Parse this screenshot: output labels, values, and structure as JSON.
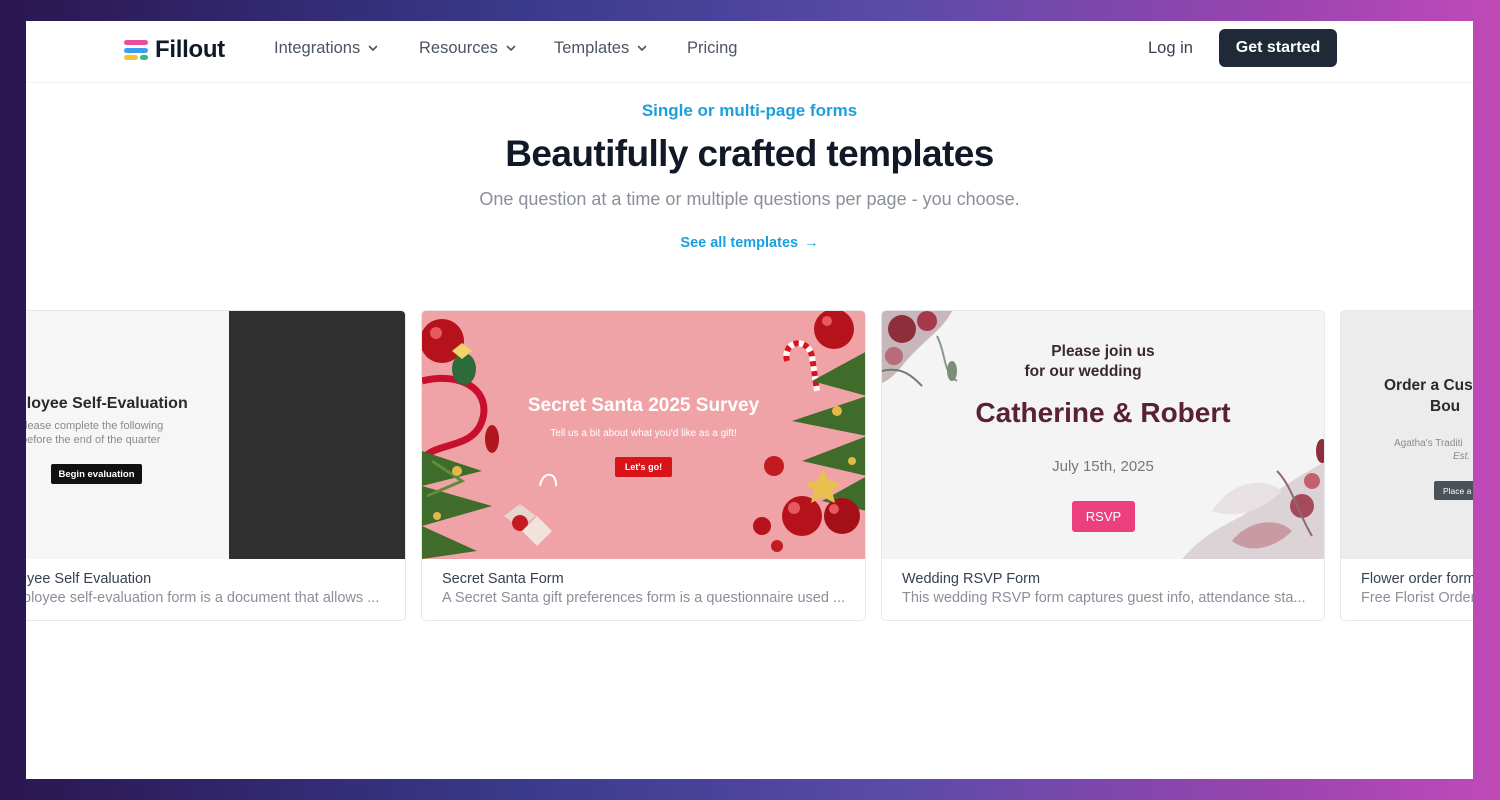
{
  "header": {
    "brand": "Fillout",
    "nav": [
      {
        "label": "Integrations"
      },
      {
        "label": "Resources"
      },
      {
        "label": "Templates"
      },
      {
        "label": "Pricing"
      }
    ],
    "login": "Log in",
    "cta": "Get started"
  },
  "hero": {
    "eyebrow": "Single or multi-page forms",
    "title": "Beautifully crafted templates",
    "subtitle": "One question at a time or multiple questions per page - you choose.",
    "link": "See all templates",
    "link_arrow": "→"
  },
  "cards": [
    {
      "title": "yee Self Evaluation",
      "desc": "ployee self-evaluation form is a document that allows ...",
      "preview": {
        "heading": "ployee Self-Evaluation",
        "line1": "lease complete the following",
        "line2": "before the end of the quarter",
        "button": "Begin evaluation"
      }
    },
    {
      "title": "Secret Santa Form",
      "desc": "A Secret Santa gift preferences form is a questionnaire used ...",
      "preview": {
        "heading": "Secret Santa 2025 Survey",
        "line1": "Tell us a bit about what you'd like as a gift!",
        "button": "Let's go!"
      }
    },
    {
      "title": "Wedding RSVP Form",
      "desc": "This wedding RSVP form captures guest info, attendance sta...",
      "preview": {
        "line1": "Please join us",
        "line2": "for our wedding",
        "heading": "Catherine & Robert",
        "date": "July 15th, 2025",
        "button": "RSVP"
      }
    },
    {
      "title": "Flower order form",
      "desc": "Free Florist Order",
      "preview": {
        "heading1": "Order a Cus",
        "heading2": "Bou",
        "line1": "Agatha's Traditi",
        "line2": "Est.",
        "button": "Place a"
      }
    }
  ],
  "colors": {
    "accent": "#1a9fe0",
    "dark_button": "#1f2937",
    "rsvp_pink": "#ec3f7d",
    "santa_red": "#d8141a",
    "wedding_text": "#5a2230"
  }
}
